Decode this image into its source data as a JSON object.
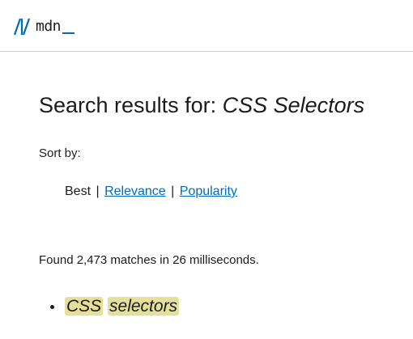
{
  "header": {
    "logo_text": "mdn",
    "logo_icon": "mdn-logo-icon",
    "accent_color": "#0069c2"
  },
  "main": {
    "title_prefix": "Search results for: ",
    "query": "CSS Selectors",
    "sort_label": "Sort by:",
    "sort_options": {
      "best": "Best",
      "relevance": "Relevance",
      "popularity": "Popularity",
      "separator": "|"
    },
    "results_count": "Found 2,473 matches in 26 milliseconds.",
    "results": [
      {
        "word1": "CSS",
        "word2": "selectors",
        "highlight_color": "#e5e099"
      }
    ]
  }
}
